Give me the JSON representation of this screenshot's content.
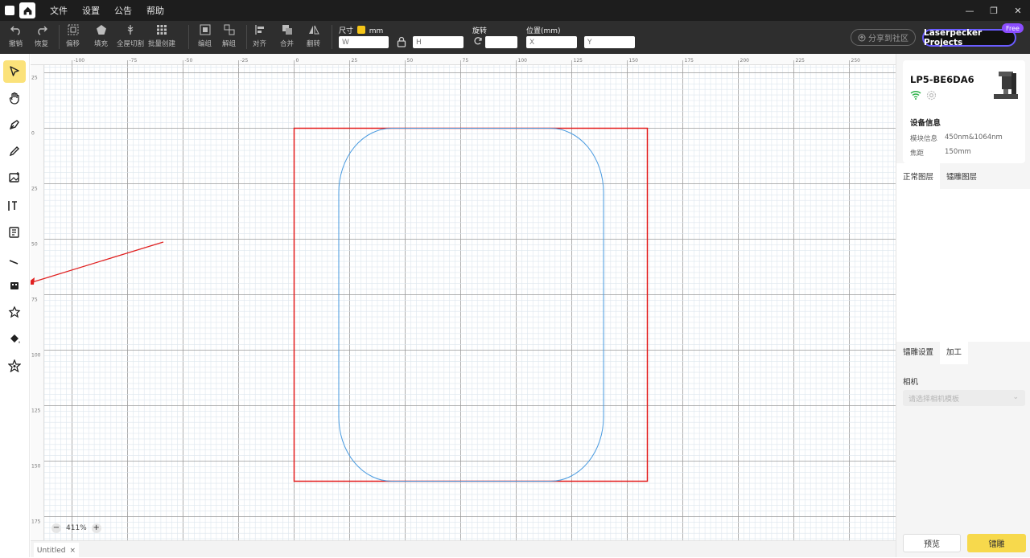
{
  "menu": {
    "items": [
      "文件",
      "设置",
      "公告",
      "帮助"
    ]
  },
  "window": {
    "minimize_glyph": "—",
    "restore_glyph": "❐",
    "close_glyph": "✕"
  },
  "toolbar": {
    "undo": "撤销",
    "redo": "恢复",
    "offset": "偏移",
    "fill": "填充",
    "full_cut": "全屋切割",
    "batch_create": "批量创建",
    "edit": "编组",
    "ungroup": "解组",
    "align": "对齐",
    "merge": "合并",
    "flip": "翻转",
    "size_label": "尺寸",
    "unit": "mm",
    "rotate_label": "旋转",
    "position_label": "位置(mm)",
    "w_placeholder": "W",
    "h_placeholder": "H",
    "x_placeholder": "X",
    "y_placeholder": "Y",
    "share_label": "分享到社区",
    "projects_label": "Laserpecker Projects",
    "free_badge": "Free"
  },
  "tools": [
    "select",
    "hand",
    "pen",
    "pencil",
    "image",
    "text",
    "template",
    "line",
    "usb-stamp",
    "shape",
    "paint-bucket",
    "star"
  ],
  "canvas": {
    "zoom_level": "411%",
    "ruler_top_labels": [
      "-100",
      "-75",
      "-50",
      "-25",
      "0",
      "25",
      "50",
      "75",
      "100",
      "125",
      "150",
      "175",
      "200",
      "225",
      "250"
    ],
    "ruler_left_labels": [
      "25",
      "0",
      "25",
      "50",
      "75",
      "100",
      "125",
      "150",
      "175"
    ],
    "doc_tab": "Untitled"
  },
  "device": {
    "name": "LP5-BE6DA6",
    "info_title": "设备信息",
    "module_key": "模块信息",
    "module_value": "450nm&1064nm",
    "focal_key": "焦距",
    "focal_value": "150mm"
  },
  "layers": {
    "tab_normal": "正常图层",
    "tab_engrave": "镭雕图层"
  },
  "process": {
    "tab_engrave_settings": "镭雕设置",
    "tab_process": "加工",
    "camera_label": "相机",
    "camera_placeholder": "请选择相机模板",
    "preview_button": "预览",
    "engrave_button": "镭雕"
  },
  "colors": {
    "accent": "#f5c518",
    "selection": "#e31b1b",
    "shape": "#4a9be0",
    "annotation_arrow": "#e02020"
  }
}
